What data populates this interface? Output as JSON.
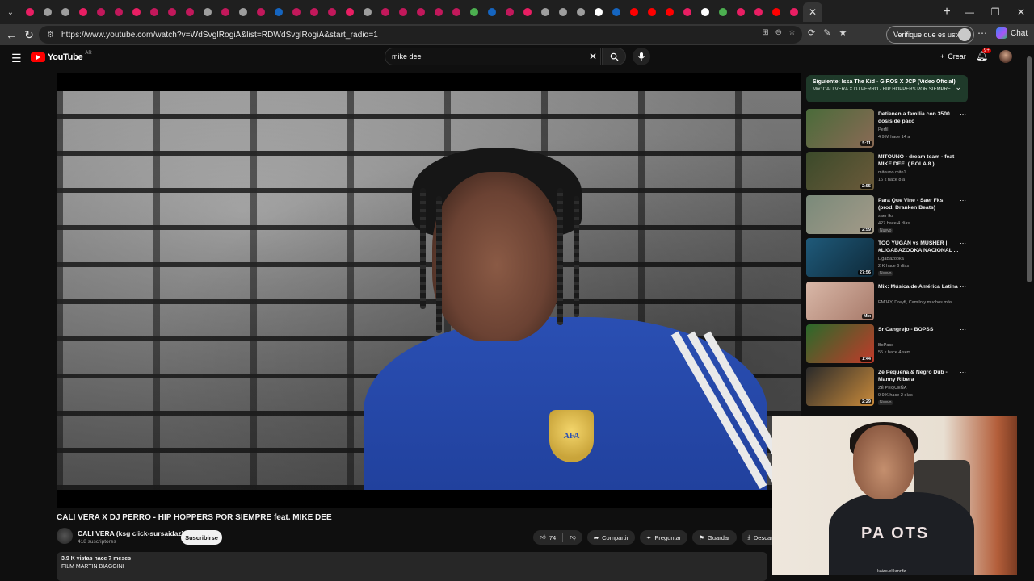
{
  "browser": {
    "url": "https://www.youtube.com/watch?v=WdSvglRogiA&list=RDWdSvglRogiA&start_radio=1",
    "verify_label": "Verifique que es usted",
    "chat_label": "Chat",
    "tab_favicon_colors": [
      "#e91e63",
      "#9e9e9e",
      "#9e9e9e",
      "#e91e63",
      "#c2185b",
      "#c2185b",
      "#e91e63",
      "#c2185b",
      "#c2185b",
      "#c2185b",
      "#9e9e9e",
      "#c2185b",
      "#9e9e9e",
      "#c2185b",
      "#1565c0",
      "#c2185b",
      "#c2185b",
      "#c2185b",
      "#e91e63",
      "#9e9e9e",
      "#c2185b",
      "#c2185b",
      "#c2185b",
      "#c2185b",
      "#c2185b",
      "#4caf50",
      "#1565c0",
      "#c2185b",
      "#e91e63",
      "#9e9e9e",
      "#9e9e9e",
      "#9e9e9e",
      "#ffffff",
      "#1565c0",
      "#ff0000",
      "#ff0000",
      "#ff0000",
      "#e91e63",
      "#ffffff",
      "#4caf50",
      "#e91e63",
      "#e91e63",
      "#ff0000",
      "#e91e63",
      "#e91e63"
    ]
  },
  "youtube": {
    "logo_text": "YouTube",
    "country_code": "AR",
    "search_value": "mike dee",
    "create_label": "Crear",
    "notif_count": "9+"
  },
  "video": {
    "title": "CALI VERA X DJ PERRO - HIP HOPPERS POR SIEMPRE feat. MIKE DEE",
    "channel": "CALI VERA (ksg click-sursaidaz)",
    "subscribers": "418 suscriptores",
    "subscribe_label": "Suscribirse",
    "likes": "74",
    "share_label": "Compartir",
    "ask_label": "Preguntar",
    "save_label": "Guardar",
    "download_label": "Descarg",
    "views_line": "3.9 K vistas  hace 7 meses",
    "desc_line": "FILM MARTIN BIAGGINI",
    "badge_text": "AFA"
  },
  "playlist": {
    "next_label": "Siguiente: Issa The Kid - GIROS X JCP (Video Oficial)",
    "subtitle": "Mix: CALI VERA X DJ PERRO - HIP HOPPERS POR SIEMPRE ..."
  },
  "recommendations": [
    {
      "title": "Detienen a familia con 3500 dosis de paco",
      "channel": "Perfil",
      "meta": "4.9 M  hace 14 a",
      "duration": "5:11",
      "badge": "",
      "thumb": [
        "#4a6b3a",
        "#8a6a55"
      ]
    },
    {
      "title": "MITOUNO - dream team - feat MIKE DEE. ( BOLA 8 )",
      "channel": "mitouno mito1",
      "meta": "16 k  hace 8 a",
      "duration": "2:55",
      "badge": "",
      "thumb": [
        "#3b4a2a",
        "#6b5a3a"
      ]
    },
    {
      "title": "Para Que Vine - Saer Fks (prod. Dranken Beats)",
      "channel": "saer fks",
      "meta": "427  hace 4 días",
      "duration": "2:59",
      "badge": "Nuevo",
      "thumb": [
        "#7a8a7a",
        "#a39a88"
      ]
    },
    {
      "title": "TOO YUGAN vs MUSHER | #LIGABAZOOKA NACIONAL ...",
      "channel": "LigaBazooka",
      "meta": "2 K  hace 6 días",
      "duration": "27:56",
      "badge": "Nuevo",
      "thumb": [
        "#1f5a7a",
        "#0e2a3a"
      ]
    },
    {
      "title": "Mix: Música de América Latina",
      "channel": "EMJAY, Dreyfi, Camilo y muchos más",
      "meta": "",
      "duration": "Mix",
      "badge": "",
      "thumb": [
        "#d9b8a8",
        "#a87a6a"
      ]
    },
    {
      "title": "Sr Cangrejo - BOPSS",
      "channel": "BoPass",
      "meta": "55 k  hace 4 sem.",
      "duration": "1:44",
      "badge": "",
      "thumb": [
        "#2a6a2a",
        "#c23a2a"
      ]
    },
    {
      "title": "Zé Pequeña & Negro Dub - Manny Ribera",
      "channel": "ZÉ PEQUEÑA",
      "meta": "9.9 K  hace 2 días",
      "duration": "2:29",
      "badge": "Nuevo",
      "thumb": [
        "#2a2a2a",
        "#c98a3a"
      ]
    }
  ],
  "webcam": {
    "shirt_print": "PA   OTS",
    "caption": "kaizo.ekkrnnfz"
  }
}
